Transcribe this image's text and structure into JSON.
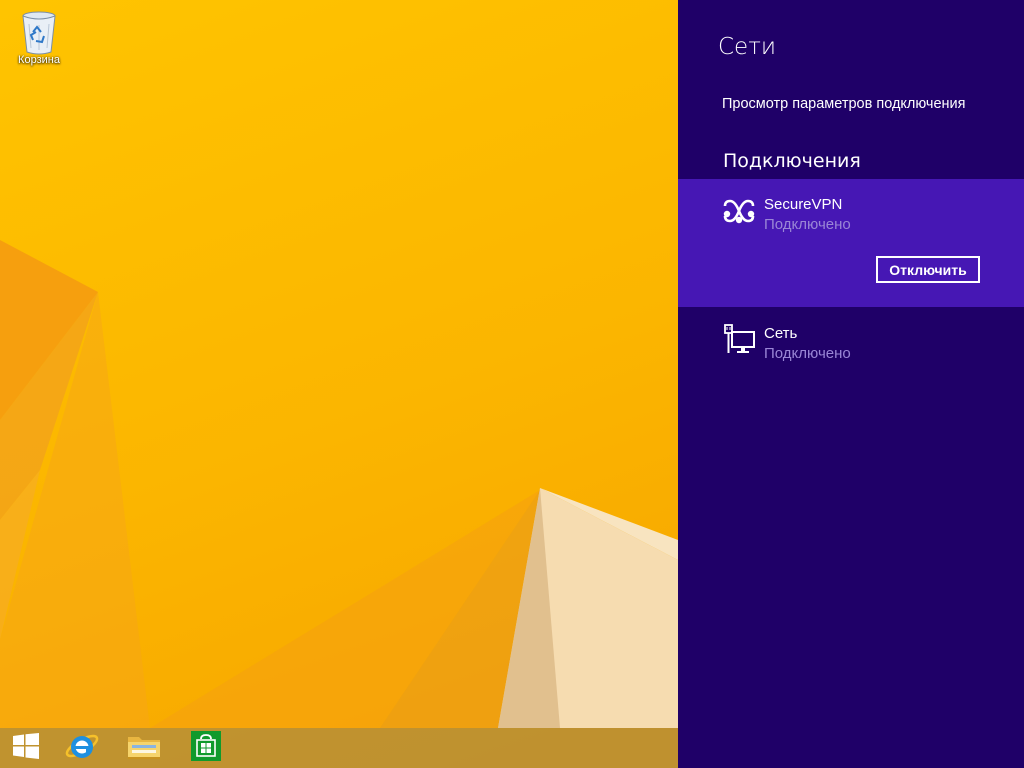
{
  "desktop": {
    "icons": [
      {
        "label": "Корзина",
        "icon": "recycle-bin-icon"
      }
    ]
  },
  "taskbar": {
    "items": [
      {
        "icon": "windows-logo-icon"
      },
      {
        "icon": "internet-explorer-icon"
      },
      {
        "icon": "file-explorer-icon"
      },
      {
        "icon": "store-icon"
      }
    ]
  },
  "charm": {
    "title": "Сети",
    "view_settings_link": "Просмотр параметров подключения",
    "section_heading": "Подключения",
    "connections": [
      {
        "name": "SecureVPN",
        "status": "Подключено",
        "icon": "vpn-icon",
        "selected": true,
        "action_label": "Отключить"
      },
      {
        "name": "Сеть",
        "status": "Подключено",
        "icon": "wired-network-icon",
        "selected": false
      }
    ],
    "colors": {
      "panel_bg": "#1f0068",
      "selected_bg": "#4617b4",
      "status_text": "#9a86d6"
    }
  }
}
